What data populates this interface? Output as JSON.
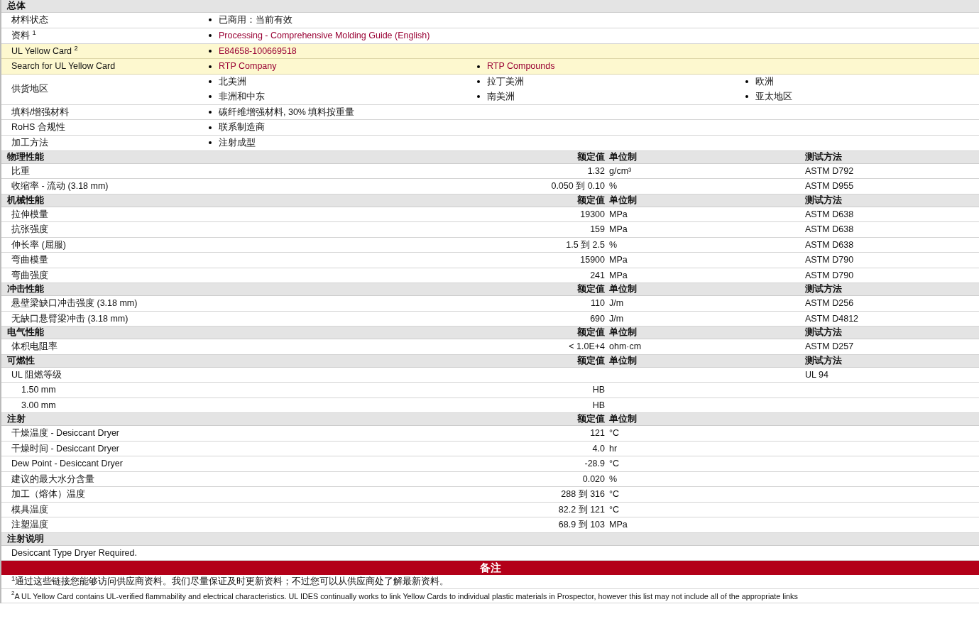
{
  "general": {
    "title": "总体",
    "rows": [
      {
        "label": "材料状态",
        "highlighted": false,
        "columns": [
          [
            {
              "text": "已商用：当前有效",
              "link": false
            }
          ]
        ]
      },
      {
        "label": "资料 $^{1}$",
        "highlighted": false,
        "columns": [
          [
            {
              "text": "Processing - Comprehensive Molding Guide (English)",
              "link": true
            }
          ]
        ]
      },
      {
        "label": "UL Yellow Card $^{2}$",
        "highlighted": true,
        "columns": [
          [
            {
              "text": "E84658-100669518",
              "link": true
            }
          ]
        ]
      },
      {
        "label": "Search for UL Yellow Card",
        "highlighted": true,
        "columns": [
          [
            {
              "text": "RTP Company",
              "link": true
            }
          ],
          [
            {
              "text": "RTP Compounds",
              "link": true
            }
          ]
        ]
      },
      {
        "label": "供货地区",
        "highlighted": false,
        "columns": [
          [
            {
              "text": "北美洲",
              "link": false
            },
            {
              "text": "非洲和中东",
              "link": false
            }
          ],
          [
            {
              "text": "拉丁美洲",
              "link": false
            },
            {
              "text": "南美洲",
              "link": false
            }
          ],
          [
            {
              "text": "欧洲",
              "link": false
            },
            {
              "text": "亚太地区",
              "link": false
            }
          ]
        ]
      },
      {
        "label": "填料/增强材料",
        "highlighted": false,
        "columns": [
          [
            {
              "text": "碳纤维增强材料, 30% 填料按重量",
              "link": false
            }
          ]
        ]
      },
      {
        "label": "RoHS 合规性",
        "highlighted": false,
        "columns": [
          [
            {
              "text": "联系制造商",
              "link": false
            }
          ]
        ]
      },
      {
        "label": "加工方法",
        "highlighted": false,
        "columns": [
          [
            {
              "text": "注射成型",
              "link": false
            }
          ]
        ]
      }
    ]
  },
  "sections": [
    {
      "title": "物理性能",
      "value_header": "额定值",
      "unit_header": "单位制",
      "method_header": "测试方法",
      "rows": [
        {
          "label": "比重",
          "value": "1.32",
          "unit": "g/cm³",
          "method": "ASTM D792"
        },
        {
          "label": "收缩率  - 流动  (3.18 mm)",
          "value": "0.050 到  0.10",
          "unit": "%",
          "method": "ASTM D955"
        }
      ]
    },
    {
      "title": "机械性能",
      "value_header": "额定值",
      "unit_header": "单位制",
      "method_header": "测试方法",
      "rows": [
        {
          "label": "拉伸模量",
          "value": "19300",
          "unit": "MPa",
          "method": "ASTM D638"
        },
        {
          "label": "抗张强度",
          "value": "159",
          "unit": "MPa",
          "method": "ASTM D638"
        },
        {
          "label": "伸长率  (屈服)",
          "value": "1.5 到  2.5",
          "unit": "%",
          "method": "ASTM D638"
        },
        {
          "label": "弯曲模量",
          "value": "15900",
          "unit": "MPa",
          "method": "ASTM D790"
        },
        {
          "label": "弯曲强度",
          "value": "241",
          "unit": "MPa",
          "method": "ASTM D790"
        }
      ]
    },
    {
      "title": "冲击性能",
      "value_header": "额定值",
      "unit_header": "单位制",
      "method_header": "测试方法",
      "rows": [
        {
          "label": "悬壁梁缺口冲击强度  (3.18 mm)",
          "value": "110",
          "unit": "J/m",
          "method": "ASTM D256"
        },
        {
          "label": "无缺口悬臂梁冲击  (3.18 mm)",
          "value": "690",
          "unit": "J/m",
          "method": "ASTM D4812"
        }
      ]
    },
    {
      "title": "电气性能",
      "value_header": "额定值",
      "unit_header": "单位制",
      "method_header": "测试方法",
      "rows": [
        {
          "label": "体积电阻率",
          "value": "< 1.0E+4",
          "unit": "ohm·cm",
          "method": "ASTM D257"
        }
      ]
    },
    {
      "title": "可燃性",
      "value_header": "额定值",
      "unit_header": "单位制",
      "method_header": "测试方法",
      "rows": [
        {
          "label": "UL 阻燃等级",
          "method": "UL 94",
          "children": [
            {
              "label": "1.50 mm",
              "value": "HB"
            },
            {
              "label": "3.00 mm",
              "value": "HB"
            }
          ]
        }
      ]
    },
    {
      "title": "注射",
      "value_header": "额定值",
      "unit_header": "单位制",
      "rows": [
        {
          "label": "干燥温度  - Desiccant Dryer",
          "value": "121",
          "unit": "°C"
        },
        {
          "label": "干燥时间  - Desiccant Dryer",
          "value": "4.0",
          "unit": "hr"
        },
        {
          "label": "Dew Point - Desiccant Dryer",
          "value": "-28.9",
          "unit": "°C"
        },
        {
          "label": "建议的最大水分含量",
          "value": "0.020",
          "unit": "%"
        },
        {
          "label": "加工（熔体）温度",
          "value": "288 到  316",
          "unit": "°C"
        },
        {
          "label": "模具温度",
          "value": "82.2 到  121",
          "unit": "°C"
        },
        {
          "label": "注塑温度",
          "value": "68.9 到  103",
          "unit": "MPa"
        }
      ]
    },
    {
      "title": "注射说明",
      "note": "Desiccant Type Dryer Required."
    }
  ],
  "notes": {
    "title": "备注",
    "items": [
      {
        "mark": "1",
        "text": "通过这些链接您能够访问供应商资料。我们尽量保证及时更新资料；不过您可以从供应商处了解最新资料。"
      },
      {
        "mark": "2",
        "text": "A UL Yellow Card contains UL-verified flammability and electrical characteristics. UL IDES continually works to link Yellow Cards to individual plastic materials in Prospector, however this list may not include all of the appropriate links"
      }
    ]
  }
}
